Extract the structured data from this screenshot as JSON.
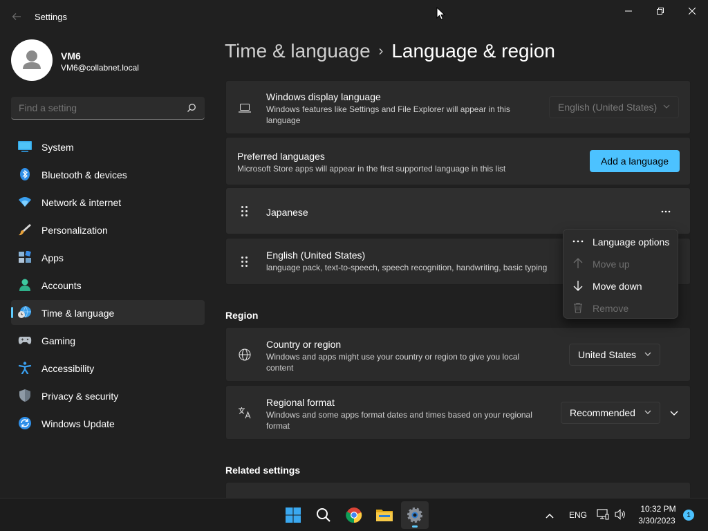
{
  "window": {
    "title": "Settings"
  },
  "profile": {
    "name": "VM6",
    "email": "VM6@collabnet.local"
  },
  "search": {
    "placeholder": "Find a setting"
  },
  "nav": {
    "items": [
      {
        "label": "System",
        "icon": "system-icon"
      },
      {
        "label": "Bluetooth & devices",
        "icon": "bluetooth-icon"
      },
      {
        "label": "Network & internet",
        "icon": "wifi-icon"
      },
      {
        "label": "Personalization",
        "icon": "brush-icon"
      },
      {
        "label": "Apps",
        "icon": "apps-icon"
      },
      {
        "label": "Accounts",
        "icon": "person-icon"
      },
      {
        "label": "Time & language",
        "icon": "globe-clock-icon",
        "active": true
      },
      {
        "label": "Gaming",
        "icon": "gamepad-icon"
      },
      {
        "label": "Accessibility",
        "icon": "accessibility-icon"
      },
      {
        "label": "Privacy & security",
        "icon": "shield-icon"
      },
      {
        "label": "Windows Update",
        "icon": "update-icon"
      }
    ]
  },
  "header": {
    "parent": "Time & language",
    "separator": "›",
    "current": "Language & region"
  },
  "display_language": {
    "title": "Windows display language",
    "desc1": "Windows features like Settings and File Explorer will appear in this",
    "desc2": "language",
    "value": "English (United States)"
  },
  "preferred": {
    "title": "Preferred languages",
    "desc": "Microsoft Store apps will appear in the first supported language in this list",
    "add_button": "Add a language"
  },
  "languages": [
    {
      "name": "Japanese",
      "detail": ""
    },
    {
      "name": "English (United States)",
      "detail": "language pack, text-to-speech, speech recognition, handwriting, basic typing"
    }
  ],
  "context_menu": {
    "items": [
      {
        "label": "Language options",
        "icon": "more-icon",
        "enabled": true
      },
      {
        "label": "Move up",
        "icon": "arrow-up-icon",
        "enabled": false
      },
      {
        "label": "Move down",
        "icon": "arrow-down-icon",
        "enabled": true
      },
      {
        "label": "Remove",
        "icon": "trash-icon",
        "enabled": false
      }
    ]
  },
  "region": {
    "heading": "Region",
    "country": {
      "title": "Country or region",
      "desc1": "Windows and apps might use your country or region to give you local",
      "desc2": "content",
      "value": "United States"
    },
    "format": {
      "title": "Regional format",
      "desc1": "Windows and some apps format dates and times based on your regional",
      "desc2": "format",
      "value": "Recommended"
    }
  },
  "related": {
    "heading": "Related settings"
  },
  "taskbar": {
    "lang": "ENG",
    "time": "10:32 PM",
    "date": "3/30/2023",
    "notification_count": "1"
  },
  "colors": {
    "accent": "#4cc2ff",
    "background": "#202020",
    "card": "#2b2b2b"
  }
}
